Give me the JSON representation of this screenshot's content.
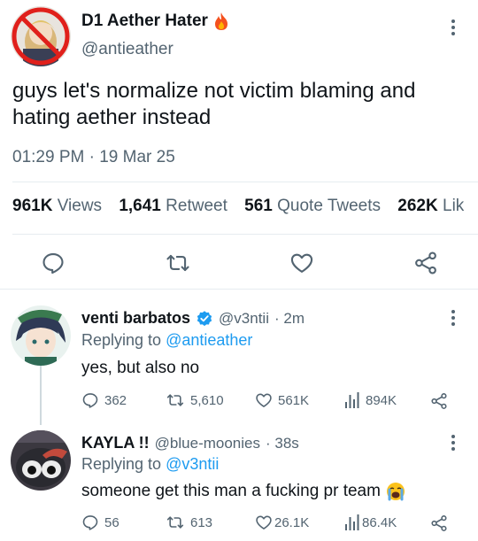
{
  "main_tweet": {
    "display_name": "D1 Aether Hater",
    "handle": "@antieather",
    "name_emoji": "🔥",
    "text_line1": "guys let's normalize not victim blaming and",
    "text_line2": "hating aether instead",
    "timestamp": "01:29 PM",
    "date": "19 Mar 25",
    "separator": "·",
    "stats": {
      "views_num": "961K",
      "views_label": "Views",
      "retweets_num": "1,641",
      "retweets_label": "Retweet",
      "quotes_num": "561",
      "quotes_label": "Quote Tweets",
      "likes_num": "262K",
      "likes_label": "Lik"
    },
    "actions": [
      "reply-icon",
      "retweet-icon",
      "like-icon",
      "share-icon"
    ]
  },
  "replies": [
    {
      "display_name": "venti barbatos",
      "verified": true,
      "handle": "@v3ntii",
      "time": "· 2m",
      "replying_prefix": "Replying to",
      "replying_to": "@antieather",
      "text": "yes, but also no",
      "metrics": {
        "replies": "362",
        "retweets": "5,610",
        "likes": "561K",
        "views": "894K"
      }
    },
    {
      "display_name": "KAYLA !!",
      "verified": false,
      "handle": "@blue-moonies",
      "time": "· 38s",
      "replying_prefix": "Replying to",
      "replying_to": "@v3ntii",
      "text": "someone get this man a fucking pr team",
      "text_emoji": "😭",
      "metrics": {
        "replies": "56",
        "retweets": "613",
        "likes": "26.1K",
        "views": "86.4K"
      }
    }
  ],
  "colors": {
    "accent": "#1d9bf0",
    "muted": "#536471",
    "text": "#0f1419",
    "divider": "#e6ecf0",
    "fire": "#f4511e"
  }
}
